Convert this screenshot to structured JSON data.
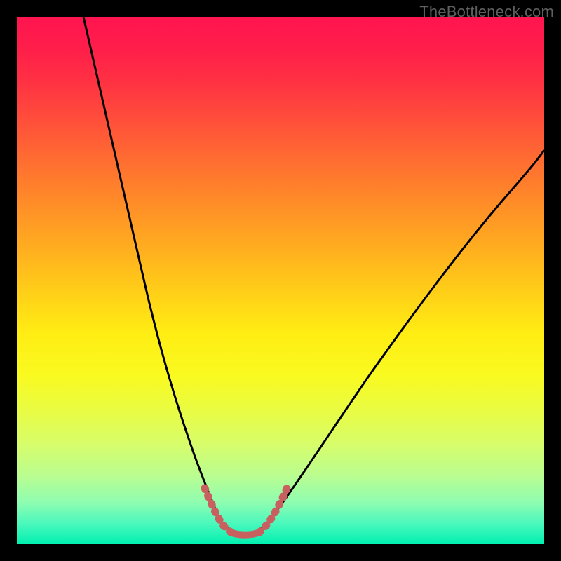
{
  "watermark": "TheBottleneck.com",
  "colors": {
    "page_bg": "#000000",
    "curve_main": "#000000",
    "curve_accent": "#c96060",
    "gradient_top": "#ff1450",
    "gradient_bottom": "#00f0b0"
  },
  "chart_data": {
    "type": "line",
    "title": "",
    "xlabel": "",
    "ylabel": "",
    "xlim": [
      0,
      100
    ],
    "ylim": [
      0,
      100
    ],
    "grid": false,
    "legend": false,
    "note": "Axes are unlabeled in the image. X expressed as percent of plot width (0–100 left→right). Y expressed as percent of plot height (0 at bottom, 100 at top). Values are estimated from pixels.",
    "series": [
      {
        "name": "left-branch",
        "x": [
          12.6,
          15.0,
          17.5,
          20.0,
          22.5,
          25.0,
          27.5,
          30.0,
          32.5,
          34.5,
          36.0,
          37.3,
          38.3
        ],
        "y": [
          100.0,
          90.0,
          80.0,
          70.0,
          60.0,
          50.0,
          40.0,
          30.0,
          21.0,
          14.0,
          9.0,
          6.0,
          4.5
        ]
      },
      {
        "name": "trough",
        "x": [
          38.3,
          39.5,
          41.0,
          43.0,
          45.0,
          46.6,
          47.8,
          48.6
        ],
        "y": [
          4.5,
          3.0,
          2.2,
          1.8,
          2.2,
          3.0,
          4.0,
          5.3
        ]
      },
      {
        "name": "right-branch",
        "x": [
          48.6,
          50.5,
          53.0,
          56.0,
          60.0,
          65.0,
          70.0,
          76.0,
          83.0,
          90.0,
          96.0,
          100.0
        ],
        "y": [
          5.3,
          8.0,
          11.5,
          16.0,
          22.5,
          30.0,
          37.5,
          46.0,
          56.0,
          64.5,
          71.0,
          75.0
        ]
      },
      {
        "name": "pink-accent-left",
        "x": [
          35.6,
          36.5,
          37.5,
          38.5,
          39.5,
          40.5
        ],
        "y": [
          10.5,
          8.0,
          6.0,
          4.5,
          3.3,
          2.6
        ]
      },
      {
        "name": "pink-flat",
        "x": [
          40.5,
          42.0,
          43.5,
          45.0,
          46.0
        ],
        "y": [
          2.6,
          2.2,
          2.1,
          2.3,
          2.8
        ]
      },
      {
        "name": "pink-accent-right",
        "x": [
          46.0,
          47.2,
          48.2,
          49.3,
          50.3,
          51.3
        ],
        "y": [
          2.8,
          3.8,
          5.2,
          7.0,
          8.8,
          11.0
        ]
      }
    ]
  }
}
